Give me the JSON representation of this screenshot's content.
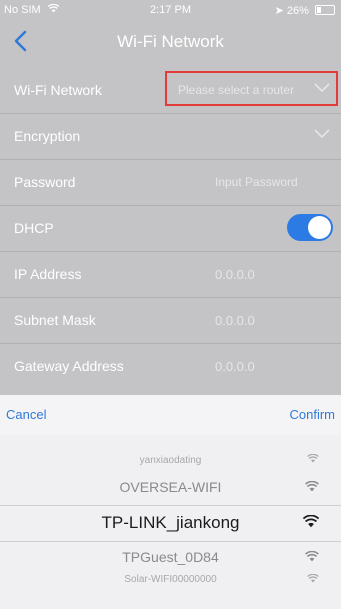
{
  "status_bar": {
    "carrier": "No SIM",
    "time": "2:17 PM",
    "battery": "26%",
    "battery_level": 0.26
  },
  "navbar": {
    "title": "Wi-Fi Network"
  },
  "form": {
    "wifi_network": {
      "label": "Wi-Fi Network",
      "placeholder": "Please select a router"
    },
    "encryption": {
      "label": "Encryption"
    },
    "password": {
      "label": "Password",
      "placeholder": "Input Password"
    },
    "dhcp": {
      "label": "DHCP",
      "enabled": true
    },
    "ip_address": {
      "label": "IP Address",
      "value": "0.0.0.0"
    },
    "subnet_mask": {
      "label": "Subnet Mask",
      "value": "0.0.0.0"
    },
    "gateway_address": {
      "label": "Gateway Address",
      "value": "0.0.0.0"
    }
  },
  "sheet": {
    "cancel_label": "Cancel",
    "confirm_label": "Confirm",
    "options": [
      "yanxiaodating",
      "OVERSEA-WIFI",
      "TP-LINK_jiankong",
      "TPGuest_0D84",
      "Solar-WIFI00000000"
    ],
    "selected": "TP-LINK_jiankong"
  },
  "colors": {
    "accent": "#2f7ad9",
    "toggle_on": "#2c7be5",
    "highlight_frame": "#e43a3a"
  },
  "icons": {
    "back": "chevron-left-icon",
    "dropdown": "chevron-down-icon",
    "signal": "wifi-signal-icon"
  }
}
